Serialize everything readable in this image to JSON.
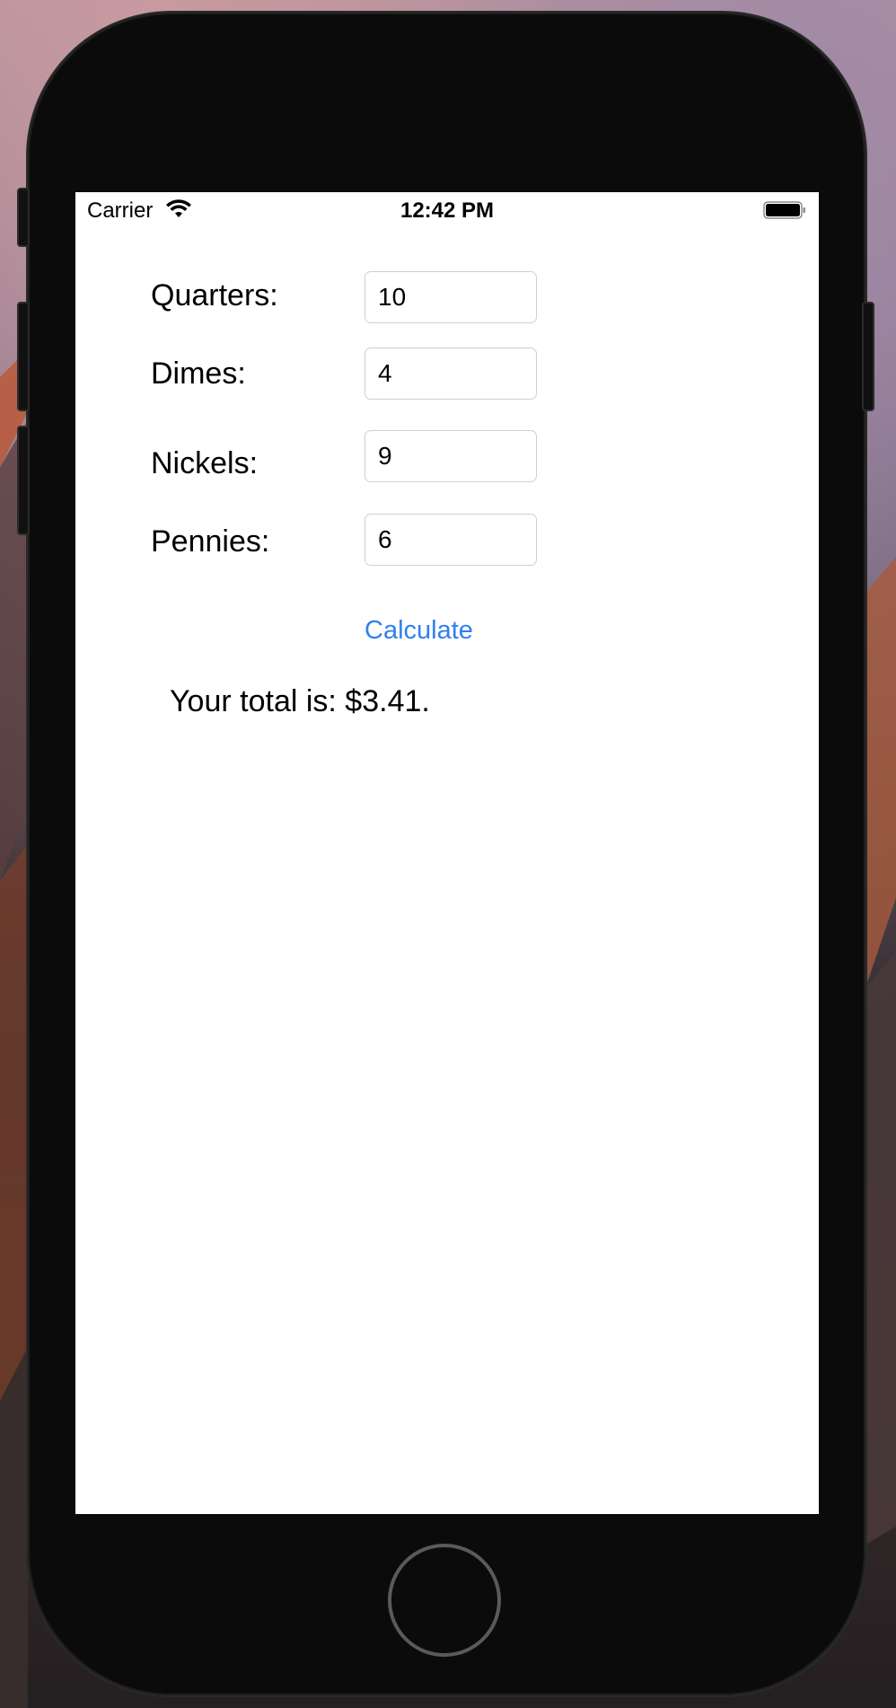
{
  "status_bar": {
    "carrier": "Carrier",
    "time": "12:42 PM",
    "wifi_icon": "wifi-icon",
    "battery_icon": "battery-icon"
  },
  "form": {
    "quarters": {
      "label": "Quarters:",
      "value": "10"
    },
    "dimes": {
      "label": "Dimes:",
      "value": "4"
    },
    "nickels": {
      "label": "Nickels:",
      "value": "9"
    },
    "pennies": {
      "label": "Pennies:",
      "value": "6"
    }
  },
  "calculate_label": "Calculate",
  "total_text": "Your total is: $3.41.",
  "colors": {
    "accent": "#2f80ed",
    "screen_bg": "#ffffff",
    "device_body": "#0b0b0b"
  }
}
